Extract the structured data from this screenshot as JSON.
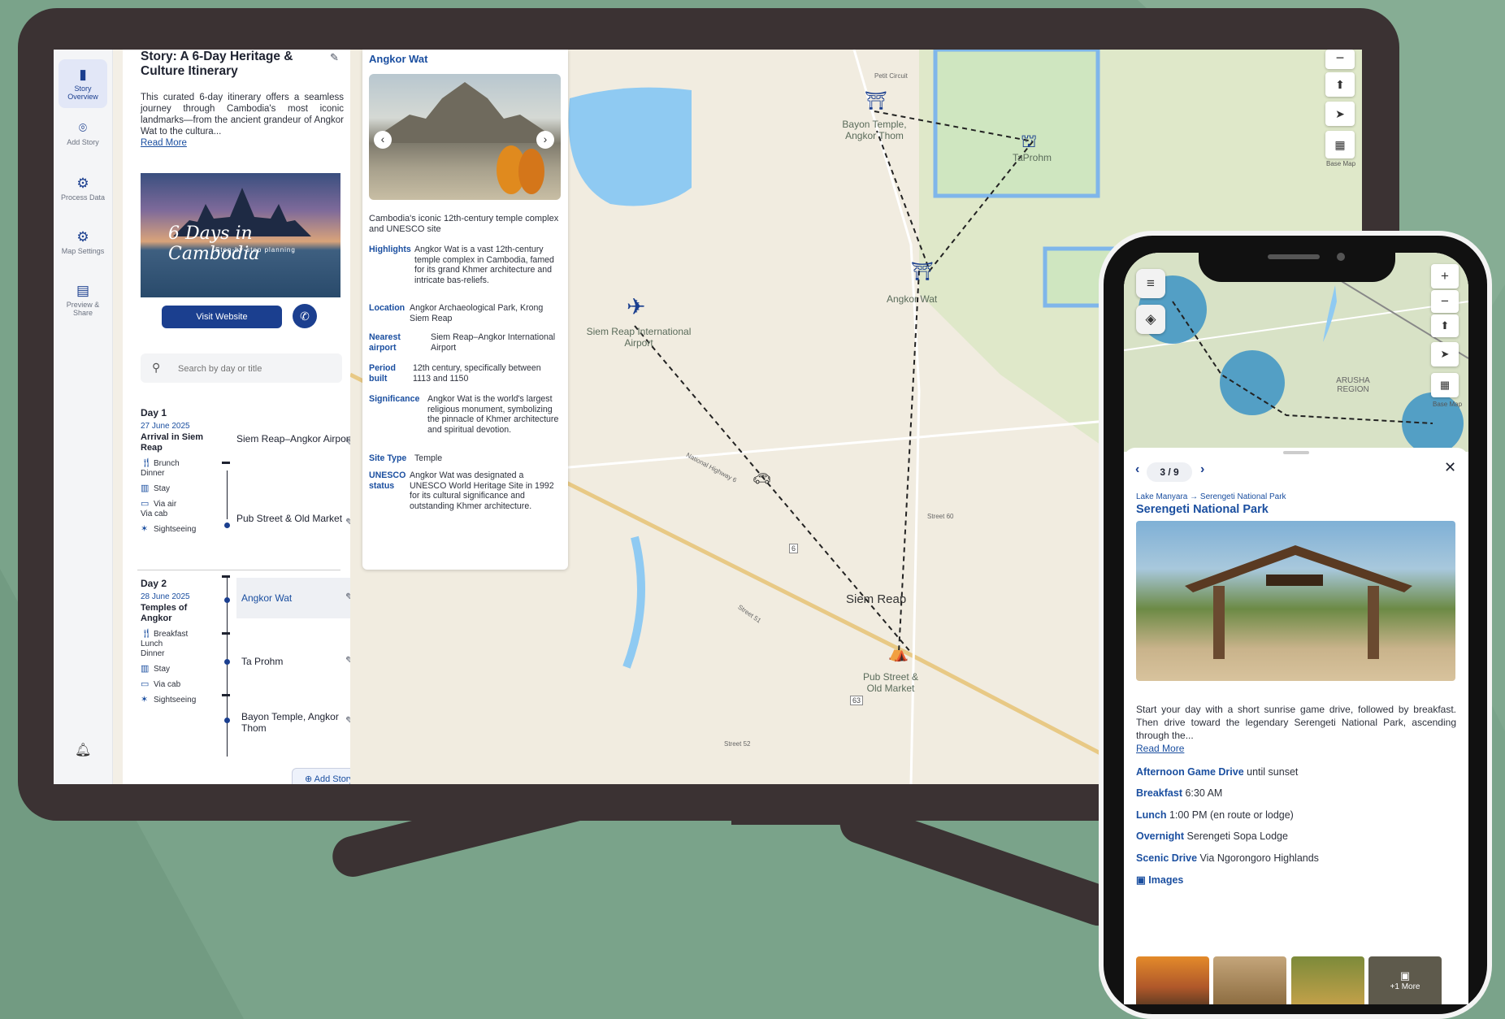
{
  "rail": {
    "items": [
      {
        "label": "Story Overview",
        "icon": "map-book-icon",
        "active": true
      },
      {
        "label": "Add Story",
        "icon": "location-pin-icon"
      },
      {
        "label": "Process Data",
        "icon": "gear-icon"
      },
      {
        "label": "Map Settings",
        "icon": "settings-icon"
      },
      {
        "label": "Preview & Share",
        "icon": "share-icon"
      }
    ]
  },
  "story": {
    "title": "Story: A 6-Day Heritage & Culture Itinerary",
    "description": "This curated 6-day itinerary offers a seamless journey through Cambodia's most iconic landmarks—from the ancient grandeur of Angkor Wat to the cultura...",
    "read_more": "Read More",
    "banner_title": "6 Days in Cambodia",
    "banner_subtitle": "Step-by-step planning",
    "visit_button": "Visit Website",
    "search_placeholder": "Search by day or title",
    "add_story": "Add Story",
    "days": [
      {
        "title": "Day 1",
        "date": "27 June 2025",
        "subtitle": "Arrival in Siem Reap",
        "meals": "Brunch\nDinner",
        "stay": "Stay",
        "transport": "Via air\nVia cab",
        "activity": "Sightseeing",
        "stops": [
          "Siem Reap–Angkor Airport",
          "Pub Street & Old Market"
        ]
      },
      {
        "title": "Day 2",
        "date": "28 June 2025",
        "subtitle": "Temples of Angkor",
        "meals": "Breakfast\nLunch\nDinner",
        "stay": "Stay",
        "transport": "Via cab",
        "activity": "Sightseeing",
        "stops": [
          "Angkor Wat",
          "Ta Prohm",
          "Bayon Temple, Angkor Thom"
        ]
      }
    ]
  },
  "info": {
    "title": "Angkor Wat",
    "caption": "Cambodia's iconic 12th-century temple complex and UNESCO site",
    "rows": [
      {
        "key": "Highlights",
        "value": "Angkor Wat is a vast 12th-century temple complex in Cambodia, famed for its grand Khmer architecture and intricate bas-reliefs."
      },
      {
        "key": "Location",
        "value": "Angkor Archaeological Park, Krong Siem Reap"
      },
      {
        "key": "Nearest airport",
        "value": "Siem Reap–Angkor International Airport"
      },
      {
        "key": "Period built",
        "value": "12th century, specifically between 1113 and 1150"
      },
      {
        "key": "Significance",
        "value": "Angkor Wat is the world's largest religious monument, symbolizing the pinnacle of Khmer architecture and spiritual devotion."
      },
      {
        "key": "Site Type",
        "value": "Temple"
      },
      {
        "key": "UNESCO status",
        "value": "Angkor Wat was designated a UNESCO World Heritage Site in 1992 for its cultural significance and outstanding Khmer architecture."
      }
    ]
  },
  "map": {
    "labels": {
      "bayon": "Bayon Temple, Angkor Thom",
      "taprohm": "TaProhm",
      "angkor": "Angkor Wat",
      "airport": "Siem Reap International Airport",
      "city": "Siem Reap",
      "pub": "Pub Street & Old Market",
      "petit": "Petit Circuit",
      "basemap": "Base Map",
      "nh6": "National Highway 6",
      "street60": "Street 60",
      "street51": "Street 51",
      "street52": "Street 52",
      "route6": "6",
      "route63": "63"
    }
  },
  "phone": {
    "pager": "3 / 9",
    "route": "Lake Manyara → Serengeti National Park",
    "title": "Serengeti National Park",
    "map_label": "ARUSHA REGION",
    "basemap": "Base Map",
    "description": "Start your day with a short sunrise game drive, followed by breakfast. Then drive toward the legendary Serengeti National Park, ascending through the...",
    "read_more": "Read More",
    "details": [
      {
        "key": "Afternoon Game Drive",
        "value": "until sunset"
      },
      {
        "key": "Breakfast",
        "value": "6:30 AM"
      },
      {
        "key": "Lunch",
        "value": "1:00 PM (en route or lodge)"
      },
      {
        "key": "Overnight",
        "value": "Serengeti Sopa Lodge"
      },
      {
        "key": "Scenic Drive",
        "value": "Via Ngorongoro Highlands"
      }
    ],
    "images_label": "Images",
    "more_label": "+1 More"
  }
}
